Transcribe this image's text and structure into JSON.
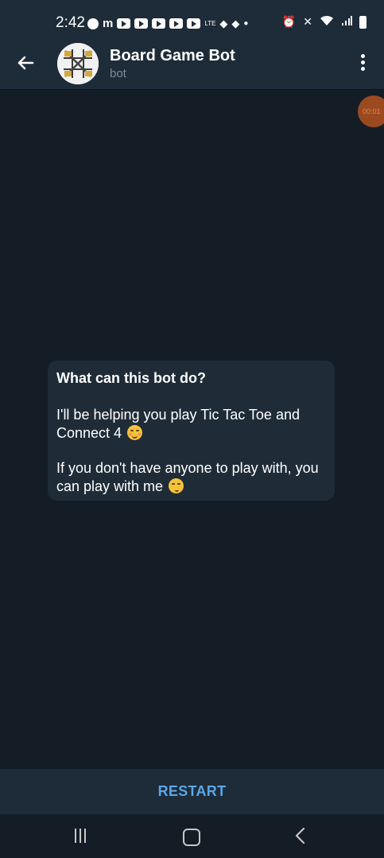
{
  "status_bar": {
    "time": "2:42",
    "icons": [
      "messenger-icon",
      "m-icon",
      "youtube-icon",
      "youtube-icon",
      "youtube-icon",
      "youtube-icon",
      "youtube-icon",
      "lte-icon",
      "diamond-icon",
      "diamond-icon",
      "dot-icon",
      "alarm-icon",
      "mute-icon",
      "wifi-icon",
      "signal-icon",
      "battery-icon"
    ],
    "lte_label": "LTE"
  },
  "app_bar": {
    "title": "Board Game Bot",
    "subtitle": "bot",
    "back_icon": "arrow-left-icon",
    "menu_icon": "more-vertical-icon"
  },
  "timer": {
    "label": "00:01"
  },
  "bot_info": {
    "heading": "What can this bot do?",
    "line1": "I'll be helping you play Tic Tac Toe and Connect 4",
    "line2": "If you don't have anyone to play with, you can play with me",
    "emoji1": "smiling-face-icon",
    "emoji2": "winking-face-icon"
  },
  "bottom": {
    "restart_label": "RESTART"
  },
  "nav": {
    "recents_icon": "recents-icon",
    "home_icon": "home-icon",
    "back_icon": "back-chevron-icon"
  },
  "colors": {
    "background": "#141d26",
    "header": "#1e2b39",
    "bubble": "#1f2c38",
    "accent": "#5aa7e5",
    "subtitle": "#7d8b99"
  }
}
